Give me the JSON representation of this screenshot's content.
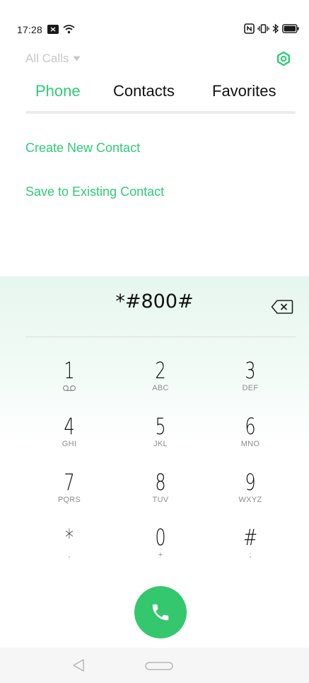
{
  "status_bar": {
    "time": "17:28",
    "left_icons": [
      "message-icon",
      "wifi-icon"
    ],
    "right_icons": [
      "nfc-icon",
      "vibrate-icon",
      "bluetooth-icon",
      "battery-icon"
    ]
  },
  "header": {
    "filter_label": "All Calls",
    "settings_icon": "settings-icon"
  },
  "tabs": [
    {
      "label": "Phone",
      "active": true
    },
    {
      "label": "Contacts",
      "active": false
    },
    {
      "label": "Favorites",
      "active": false
    }
  ],
  "actions": {
    "create": "Create New Contact",
    "save": "Save to Existing Contact"
  },
  "dialer": {
    "number": "*#800#",
    "keys": [
      {
        "digit": "1",
        "sub": "voicemail"
      },
      {
        "digit": "2",
        "sub": "ABC"
      },
      {
        "digit": "3",
        "sub": "DEF"
      },
      {
        "digit": "4",
        "sub": "GHI"
      },
      {
        "digit": "5",
        "sub": "JKL"
      },
      {
        "digit": "6",
        "sub": "MNO"
      },
      {
        "digit": "7",
        "sub": "PQRS"
      },
      {
        "digit": "8",
        "sub": "TUV"
      },
      {
        "digit": "9",
        "sub": "WXYZ"
      },
      {
        "digit": "*",
        "sub": ","
      },
      {
        "digit": "0",
        "sub": "+"
      },
      {
        "digit": "#",
        "sub": ";"
      }
    ]
  },
  "colors": {
    "accent": "#2ecb76",
    "call_button": "#34c76d"
  }
}
